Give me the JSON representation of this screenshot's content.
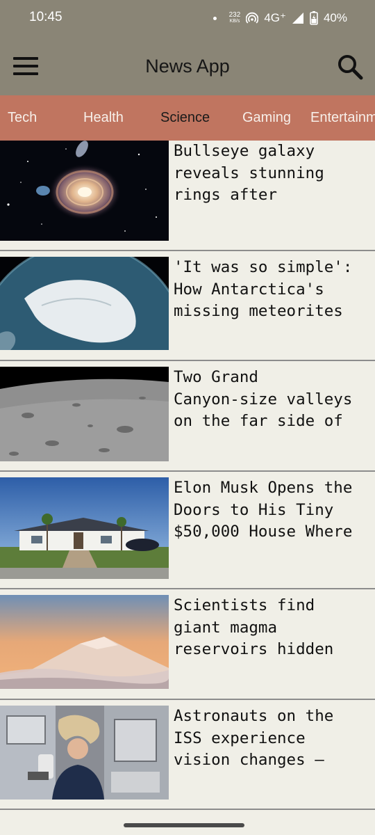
{
  "status_bar": {
    "time": "10:45",
    "speed_value": "232",
    "speed_unit": "KB/s",
    "network": "4G⁺",
    "battery": "40%"
  },
  "header": {
    "title": "News App",
    "menu_icon": "hamburger-menu-icon",
    "search_icon": "search-icon"
  },
  "tabs": [
    {
      "label": "Tech",
      "active": false
    },
    {
      "label": "Health",
      "active": false
    },
    {
      "label": "Science",
      "active": true
    },
    {
      "label": "Gaming",
      "active": false
    },
    {
      "label": "Entertainm",
      "active": false
    }
  ],
  "articles": [
    {
      "headline": "Bullseye galaxy\nreveals stunning\nrings after",
      "thumbnail": "spiral galaxy in space"
    },
    {
      "headline": "'It was so simple':\nHow Antarctica's\nmissing meteorites",
      "thumbnail": "Antarctica seen from space"
    },
    {
      "headline": "Two Grand\nCanyon-size valleys\non the far side of",
      "thumbnail": "lunar surface craters"
    },
    {
      "headline": "Elon Musk Opens the\nDoors to His Tiny\n$50,000 House Where",
      "thumbnail": "small white house with car"
    },
    {
      "headline": "Scientists find\ngiant magma\nreservoirs hidden",
      "thumbnail": "snowy volcano above clouds"
    },
    {
      "headline": "Astronauts on the\nISS experience\nvision changes —",
      "thumbnail": "astronaut aboard ISS"
    }
  ],
  "colors": {
    "app_bar": "#8a8576",
    "tab_bar": "#c07560",
    "background": "#f0efe7"
  }
}
